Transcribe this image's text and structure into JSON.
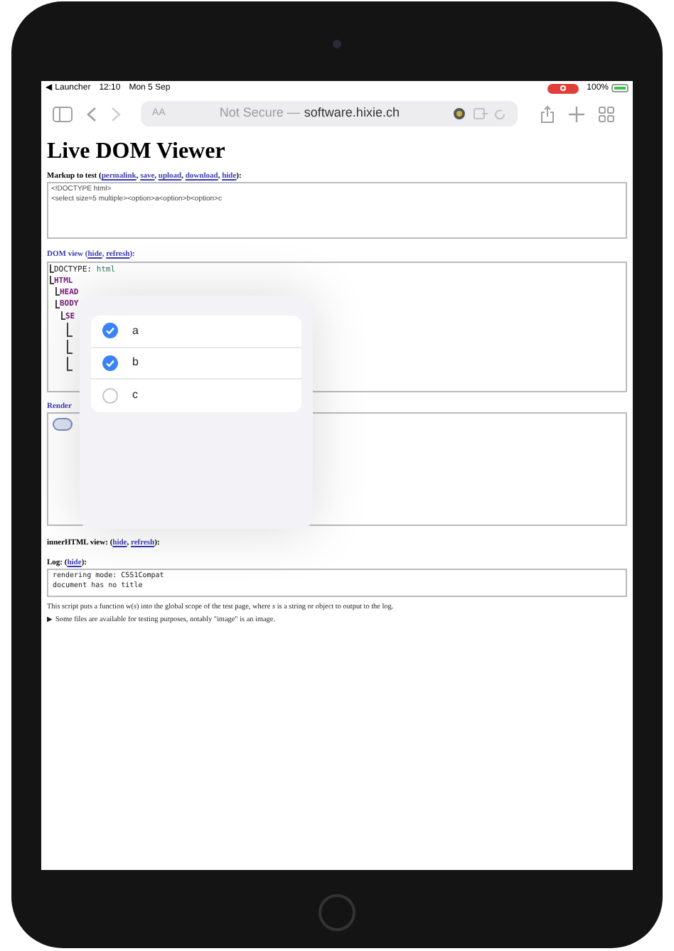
{
  "status_bar": {
    "back_app": "◀ Launcher",
    "time": "12:10",
    "date": "Mon 5 Sep",
    "battery": "100%"
  },
  "address_bar": {
    "text_size": "AA",
    "security": "Not Secure —",
    "domain": "software.hixie.ch"
  },
  "page": {
    "title": "Live DOM Viewer",
    "markup": {
      "label": "Markup to test",
      "open": "(",
      "separator": ",",
      "close": "):",
      "links": [
        "permalink",
        "save",
        "upload",
        "download",
        "hide"
      ],
      "lines": [
        "<!DOCTYPE html>",
        "<select size=5 multiple><option>a<option>b<option>c"
      ]
    },
    "dom_view": {
      "label": "DOM view",
      "open": "(",
      "separator": ",",
      "close": "):",
      "links": [
        "hide",
        "refresh"
      ],
      "tree": [
        {
          "kind": "doctype",
          "label": "DOCTYPE:",
          "value": "html"
        },
        {
          "kind": "element",
          "label": "HTML",
          "children": [
            {
              "kind": "element",
              "label": "HEAD"
            },
            {
              "kind": "element",
              "label": "BODY",
              "children": [
                {
                  "kind": "element",
                  "label": "SE",
                  "children": [
                    {
                      "kind": "hidden"
                    },
                    {
                      "kind": "hidden"
                    },
                    {
                      "kind": "hidden"
                    }
                  ]
                }
              ]
            }
          ]
        }
      ]
    },
    "rendered_view": {
      "label": "Render"
    },
    "inner_html": {
      "label": "innerHTML view:",
      "open": "(",
      "separator": ",",
      "close": "):",
      "links": [
        "hide",
        "refresh"
      ]
    },
    "log": {
      "label": "Log:",
      "open": "(",
      "close": "):",
      "links": [
        "hide"
      ],
      "lines": [
        "rendering mode: CSS1Compat",
        "document has no title"
      ]
    },
    "notes": [
      {
        "text": "This script puts a function w(*s*) into the global scope of the test page, where *s* is a string or object to output to the log."
      },
      {
        "marker": "▶",
        "text": "Some files are available for testing purposes, notably \"image\" is an image."
      }
    ]
  },
  "picker": {
    "options": [
      {
        "label": "a",
        "checked": true
      },
      {
        "label": "b",
        "checked": true
      },
      {
        "label": "c",
        "checked": false
      }
    ]
  }
}
